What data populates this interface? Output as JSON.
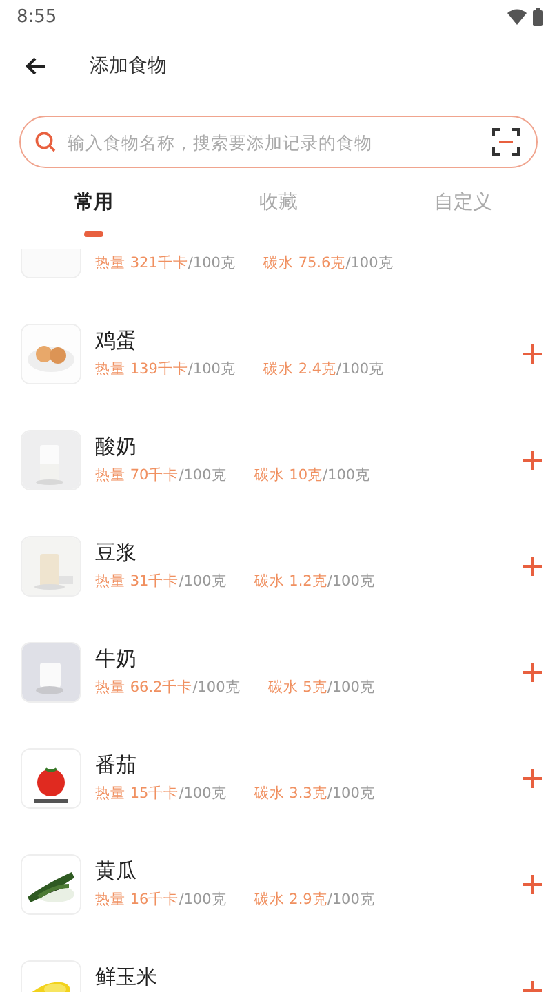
{
  "status_bar": {
    "time": "8:55"
  },
  "header": {
    "title": "添加食物"
  },
  "search": {
    "placeholder": "输入食物名称，搜索要添加记录的食物"
  },
  "tabs": [
    {
      "label": "常用",
      "selected": true
    },
    {
      "label": "收藏",
      "selected": false
    },
    {
      "label": "自定义",
      "selected": false
    }
  ],
  "foods": [
    {
      "calories": "热量 321千卡",
      "calories_unit": "/100克",
      "carbs": "碳水 75.6克",
      "carbs_unit": "/100克"
    },
    {
      "name": "鸡蛋",
      "calories": "热量 139千卡",
      "calories_unit": "/100克",
      "carbs": "碳水 2.4克",
      "carbs_unit": "/100克"
    },
    {
      "name": "酸奶",
      "calories": "热量 70千卡",
      "calories_unit": "/100克",
      "carbs": "碳水 10克",
      "carbs_unit": "/100克"
    },
    {
      "name": "豆浆",
      "calories": "热量 31千卡",
      "calories_unit": "/100克",
      "carbs": "碳水 1.2克",
      "carbs_unit": "/100克"
    },
    {
      "name": "牛奶",
      "calories": "热量 66.2千卡",
      "calories_unit": "/100克",
      "carbs": "碳水 5克",
      "carbs_unit": "/100克"
    },
    {
      "name": "番茄",
      "calories": "热量 15千卡",
      "calories_unit": "/100克",
      "carbs": "碳水 3.3克",
      "carbs_unit": "/100克"
    },
    {
      "name": "黄瓜",
      "calories": "热量 16千卡",
      "calories_unit": "/100克",
      "carbs": "碳水 2.9克",
      "carbs_unit": "/100克"
    },
    {
      "name": "鲜玉米"
    }
  ]
}
